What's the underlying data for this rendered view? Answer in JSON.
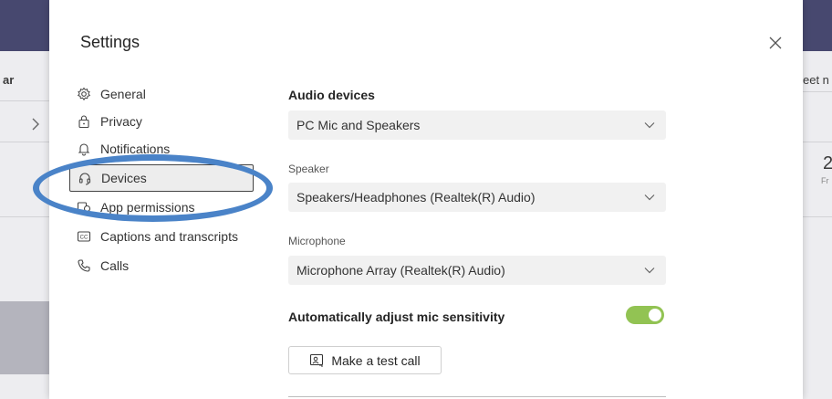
{
  "background": {
    "left_fragment": "ar",
    "right_fragment": "eet n",
    "right_date_number": "2",
    "right_date_sub": "Fr"
  },
  "dialog": {
    "title": "Settings",
    "close_icon": "close-icon"
  },
  "nav": {
    "items": [
      {
        "label": "General",
        "icon": "gear-icon"
      },
      {
        "label": "Privacy",
        "icon": "lock-icon"
      },
      {
        "label": "Notifications",
        "icon": "bell-icon"
      },
      {
        "label": "Devices",
        "icon": "headset-icon",
        "selected": true
      },
      {
        "label": "App permissions",
        "icon": "permissions-icon"
      },
      {
        "label": "Captions and transcripts",
        "icon": "cc-icon"
      },
      {
        "label": "Calls",
        "icon": "phone-icon"
      }
    ]
  },
  "devices": {
    "audio_devices_title": "Audio devices",
    "audio_devices_value": "PC Mic and Speakers",
    "speaker_label": "Speaker",
    "speaker_value": "Speakers/Headphones (Realtek(R) Audio)",
    "microphone_label": "Microphone",
    "microphone_value": "Microphone Array (Realtek(R) Audio)",
    "auto_adjust_label": "Automatically adjust mic sensitivity",
    "auto_adjust_on": true,
    "test_call_label": "Make a test call"
  },
  "colors": {
    "toggle_on": "#92c353",
    "annotation": "#4a83c8",
    "header_bg": "#47486f"
  }
}
